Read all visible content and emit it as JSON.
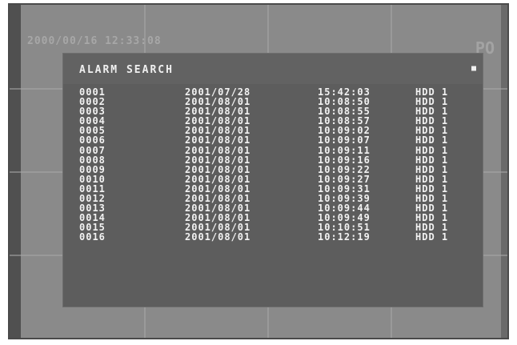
{
  "background": {
    "timestamp": "2000/00/16 12:33:08",
    "corner_label": "PO"
  },
  "panel": {
    "title": "ALARM SEARCH",
    "close_icon": "close-icon"
  },
  "rows": [
    {
      "id": "0001",
      "date": "2001/07/28",
      "time": "15:42:03",
      "device": "HDD 1"
    },
    {
      "id": "0002",
      "date": "2001/08/01",
      "time": "10:08:50",
      "device": "HDD 1"
    },
    {
      "id": "0003",
      "date": "2001/08/01",
      "time": "10:08:55",
      "device": "HDD 1"
    },
    {
      "id": "0004",
      "date": "2001/08/01",
      "time": "10:08:57",
      "device": "HDD 1"
    },
    {
      "id": "0005",
      "date": "2001/08/01",
      "time": "10:09:02",
      "device": "HDD 1"
    },
    {
      "id": "0006",
      "date": "2001/08/01",
      "time": "10:09:07",
      "device": "HDD 1"
    },
    {
      "id": "0007",
      "date": "2001/08/01",
      "time": "10:09:11",
      "device": "HDD 1"
    },
    {
      "id": "0008",
      "date": "2001/08/01",
      "time": "10:09:16",
      "device": "HDD 1"
    },
    {
      "id": "0009",
      "date": "2001/08/01",
      "time": "10:09:22",
      "device": "HDD 1"
    },
    {
      "id": "0010",
      "date": "2001/08/01",
      "time": "10:09:27",
      "device": "HDD 1"
    },
    {
      "id": "0011",
      "date": "2001/08/01",
      "time": "10:09:31",
      "device": "HDD 1"
    },
    {
      "id": "0012",
      "date": "2001/08/01",
      "time": "10:09:39",
      "device": "HDD 1"
    },
    {
      "id": "0013",
      "date": "2001/08/01",
      "time": "10:09:44",
      "device": "HDD 1"
    },
    {
      "id": "0014",
      "date": "2001/08/01",
      "time": "10:09:49",
      "device": "HDD 1"
    },
    {
      "id": "0015",
      "date": "2001/08/01",
      "time": "10:10:51",
      "device": "HDD 1"
    },
    {
      "id": "0016",
      "date": "2001/08/01",
      "time": "10:12:19",
      "device": "HDD 1"
    }
  ]
}
